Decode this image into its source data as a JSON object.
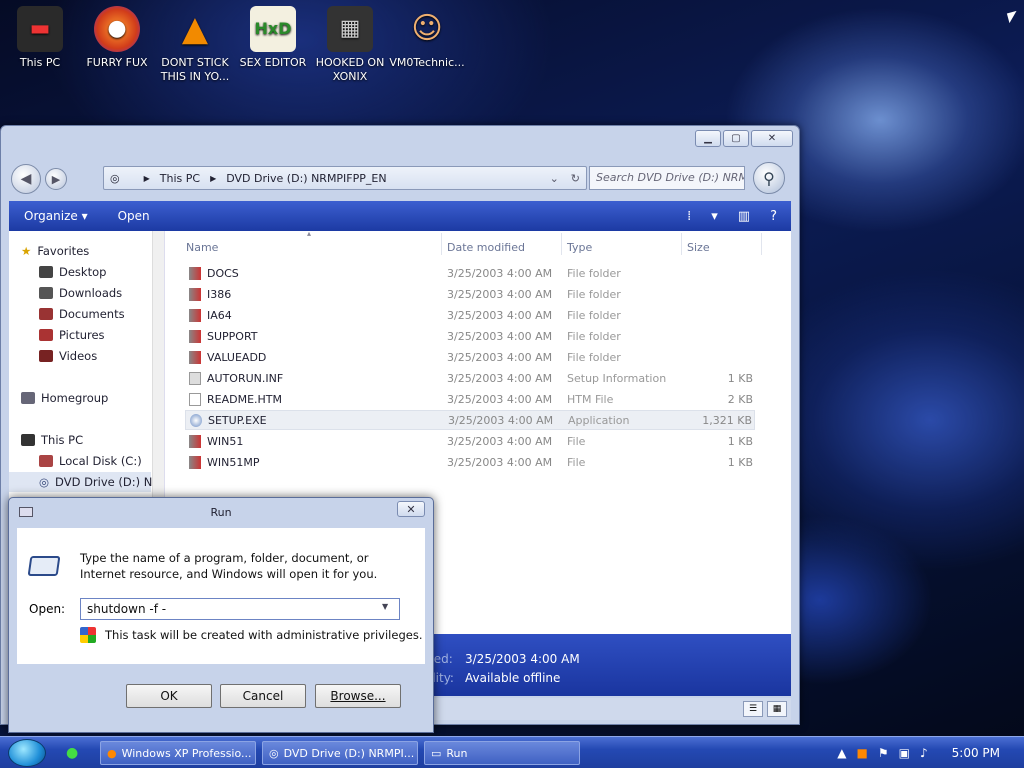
{
  "desktop": {
    "icons": [
      {
        "label": "This PC",
        "glyph": "▬"
      },
      {
        "label": "FURRY FUX",
        "glyph": "●"
      },
      {
        "label": "DONT STICK THIS IN YO...",
        "glyph": "▲"
      },
      {
        "label": "SEX EDITOR",
        "glyph": "HxD"
      },
      {
        "label": "HOOKED ON XONIX",
        "glyph": "▦"
      },
      {
        "label": "VM0Technic...",
        "glyph": "☺"
      }
    ]
  },
  "explorer": {
    "window_controls": {
      "minimize": "▁",
      "maximize": "▢",
      "close": "✕"
    },
    "address": {
      "segment1": "This PC",
      "segment2": "DVD Drive (D:) NRMPIFPP_EN"
    },
    "search_placeholder": "Search DVD Drive (D:) NRM...",
    "toolbar": {
      "organize": "Organize",
      "open": "Open"
    },
    "nav": {
      "favorites": "Favorites",
      "desktop": "Desktop",
      "downloads": "Downloads",
      "documents": "Documents",
      "pictures": "Pictures",
      "videos": "Videos",
      "homegroup": "Homegroup",
      "this_pc": "This PC",
      "local_disk": "Local Disk (C:)",
      "dvd_drive": "DVD Drive (D:) NR"
    },
    "columns": {
      "name": "Name",
      "date": "Date modified",
      "type": "Type",
      "size": "Size"
    },
    "files": [
      {
        "name": "DOCS",
        "date": "3/25/2003 4:00 AM",
        "type": "File folder",
        "size": ""
      },
      {
        "name": "I386",
        "date": "3/25/2003 4:00 AM",
        "type": "File folder",
        "size": ""
      },
      {
        "name": "IA64",
        "date": "3/25/2003 4:00 AM",
        "type": "File folder",
        "size": ""
      },
      {
        "name": "SUPPORT",
        "date": "3/25/2003 4:00 AM",
        "type": "File folder",
        "size": ""
      },
      {
        "name": "VALUEADD",
        "date": "3/25/2003 4:00 AM",
        "type": "File folder",
        "size": ""
      },
      {
        "name": "AUTORUN.INF",
        "date": "3/25/2003 4:00 AM",
        "type": "Setup Information",
        "size": "1 KB"
      },
      {
        "name": "README.HTM",
        "date": "3/25/2003 4:00 AM",
        "type": "HTM File",
        "size": "2 KB"
      },
      {
        "name": "SETUP.EXE",
        "date": "3/25/2003 4:00 AM",
        "type": "Application",
        "size": "1,321 KB"
      },
      {
        "name": "WIN51",
        "date": "3/25/2003 4:00 AM",
        "type": "File",
        "size": "1 KB"
      },
      {
        "name": "WIN51MP",
        "date": "3/25/2003 4:00 AM",
        "type": "File",
        "size": "1 KB"
      }
    ],
    "details": {
      "label1": "ted:",
      "value1": "3/25/2003 4:00 AM",
      "label2": "ility:",
      "value2": "Available offline"
    }
  },
  "run": {
    "title": "Run",
    "description": "Type the name of a program, folder, document, or Internet resource, and Windows will open it for you.",
    "open_label": "Open:",
    "input_value": "shutdown -f -",
    "admin_note": "This task will be created with administrative privileges.",
    "ok": "OK",
    "cancel": "Cancel",
    "browse": "Browse..."
  },
  "taskbar": {
    "tasks": [
      {
        "label": "Windows XP Professio..."
      },
      {
        "label": "DVD Drive (D:) NRMPI..."
      },
      {
        "label": "Run"
      }
    ],
    "clock": "5:00 PM"
  },
  "colors": {
    "accent": "#1f3ba6",
    "taskbar": "#2449b3",
    "selection": "#eceff4"
  }
}
